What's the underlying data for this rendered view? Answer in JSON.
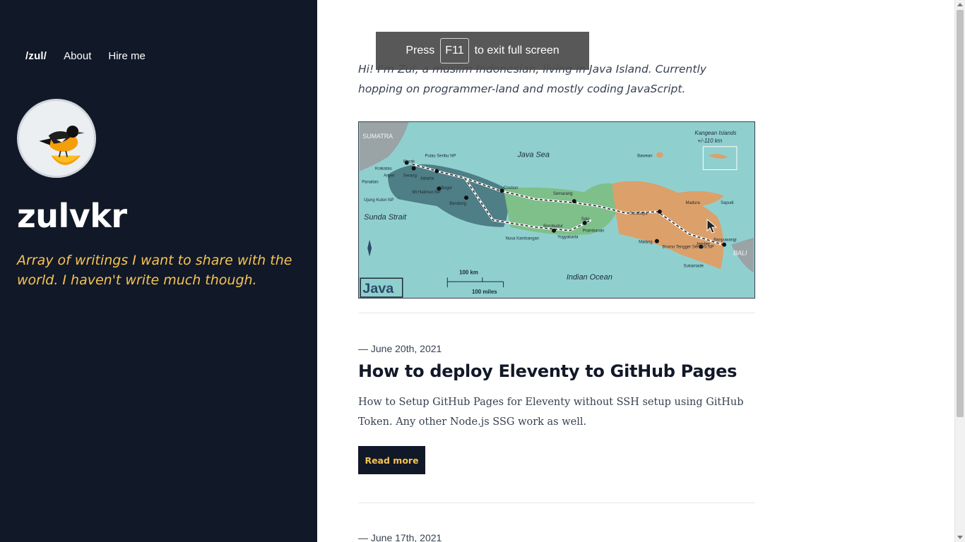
{
  "nav": {
    "brand": "/zul/",
    "about": "About",
    "hire": "Hire me"
  },
  "site": {
    "title": "zulvkr",
    "tagline": "Array of writings I want to share with the world. I haven't write much though."
  },
  "intro": "Hi! I'm Zul, a muslim Indonesian, living in Java Island. Currently hopping on programmer-land and mostly coding JavaScript.",
  "map": {
    "labels": {
      "sumatra": "SUMATRA",
      "java_sea": "Java Sea",
      "kangean": "Kangean Islands",
      "kangean_dist": "+/-110 km",
      "bawean": "Bawean",
      "madura": "Madura",
      "sapudi": "Sapudi",
      "sunda_strait": "Sunda Strait",
      "indian_ocean": "Indian Ocean",
      "bali": "BALI",
      "java": "Java",
      "scale_km": "100 km",
      "scale_mi": "100 miles",
      "merak": "Merak",
      "serang": "Serang",
      "jakarta": "Jakarta",
      "bogor": "Bogor",
      "bandung": "Bandung",
      "cirebon": "Cirebon",
      "semarang": "Semarang",
      "surabaya": "Surabaya",
      "yogyakarta": "Yogyakarta",
      "solo": "Solo",
      "malang": "Malang",
      "jember": "Jember",
      "banyuwangi": "Banyuwangi",
      "borobudur": "Borobudur",
      "prambanan": "Prambanan",
      "nusa_kambangan": "Nusa Kambangan",
      "krakatau": "Krakatau",
      "anyer": "Anyer",
      "panaitan": "Panaitan",
      "ujung_kulon": "Ujung Kulon NP",
      "pulau_seribu": "Pulau Seribu NP",
      "mt_halimun": "Mt Halimun NP",
      "sukamade": "Sukamade",
      "bromo": "Bromo Tengger Semeru NP"
    }
  },
  "posts": [
    {
      "date": "— June 20th, 2021",
      "title": "How to deploy Eleventy to GitHub Pages",
      "excerpt": "How to Setup GitHub Pages for Eleventy without SSH setup using GitHub Token. Any other Node.js SSG work as well.",
      "read_more": "Read more"
    },
    {
      "date": "— June 17th, 2021"
    }
  ],
  "toast": {
    "press": "Press",
    "key": "F11",
    "rest": "to exit full screen"
  },
  "colors": {
    "sidebar_bg": "#111827",
    "accent": "#f6c453",
    "text": "#374151"
  }
}
